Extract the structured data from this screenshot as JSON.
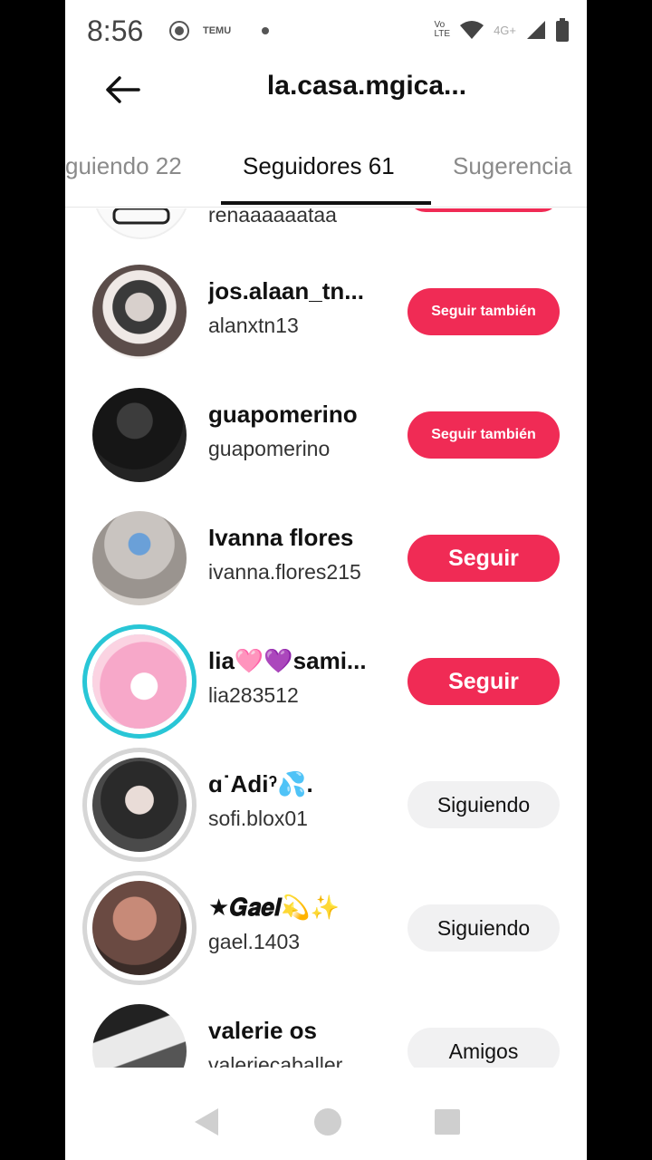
{
  "status_bar": {
    "time": "8:56",
    "temu_label": "TEMU",
    "network": "4G+"
  },
  "header": {
    "title": "la.casa.mgica..."
  },
  "tabs": [
    {
      "label": "guiendo 22"
    },
    {
      "label": "Seguidores 61"
    },
    {
      "label": "Sugerencia"
    }
  ],
  "rows": [
    {
      "name": "",
      "handle": "renaaaaaataa",
      "button": ""
    },
    {
      "name": "jos.alaan_tn...",
      "handle": "alanxtn13",
      "button": "Seguir también"
    },
    {
      "name": "guapomerino",
      "handle": "guapomerino",
      "button": "Seguir también"
    },
    {
      "name": "Ivanna flores",
      "handle": "ivanna.flores215",
      "button": "Seguir"
    },
    {
      "name": "lia🩷💜sami...",
      "handle": "lia283512",
      "button": "Seguir"
    },
    {
      "name": "ɑ˙Adiˀ💦.",
      "handle": "sofi.blox01",
      "button": "Siguiendo"
    },
    {
      "name": "★𝑮𝒂𝒆𝒍💫✨",
      "handle": "gael.1403",
      "button": "Siguiendo"
    },
    {
      "name": "valerie os",
      "handle": "valeriecaballer",
      "button": "Amigos"
    }
  ],
  "colors": {
    "accent_red": "#f02b55",
    "story_ring": "#29c6d6",
    "grey_button": "#f1f1f2"
  }
}
